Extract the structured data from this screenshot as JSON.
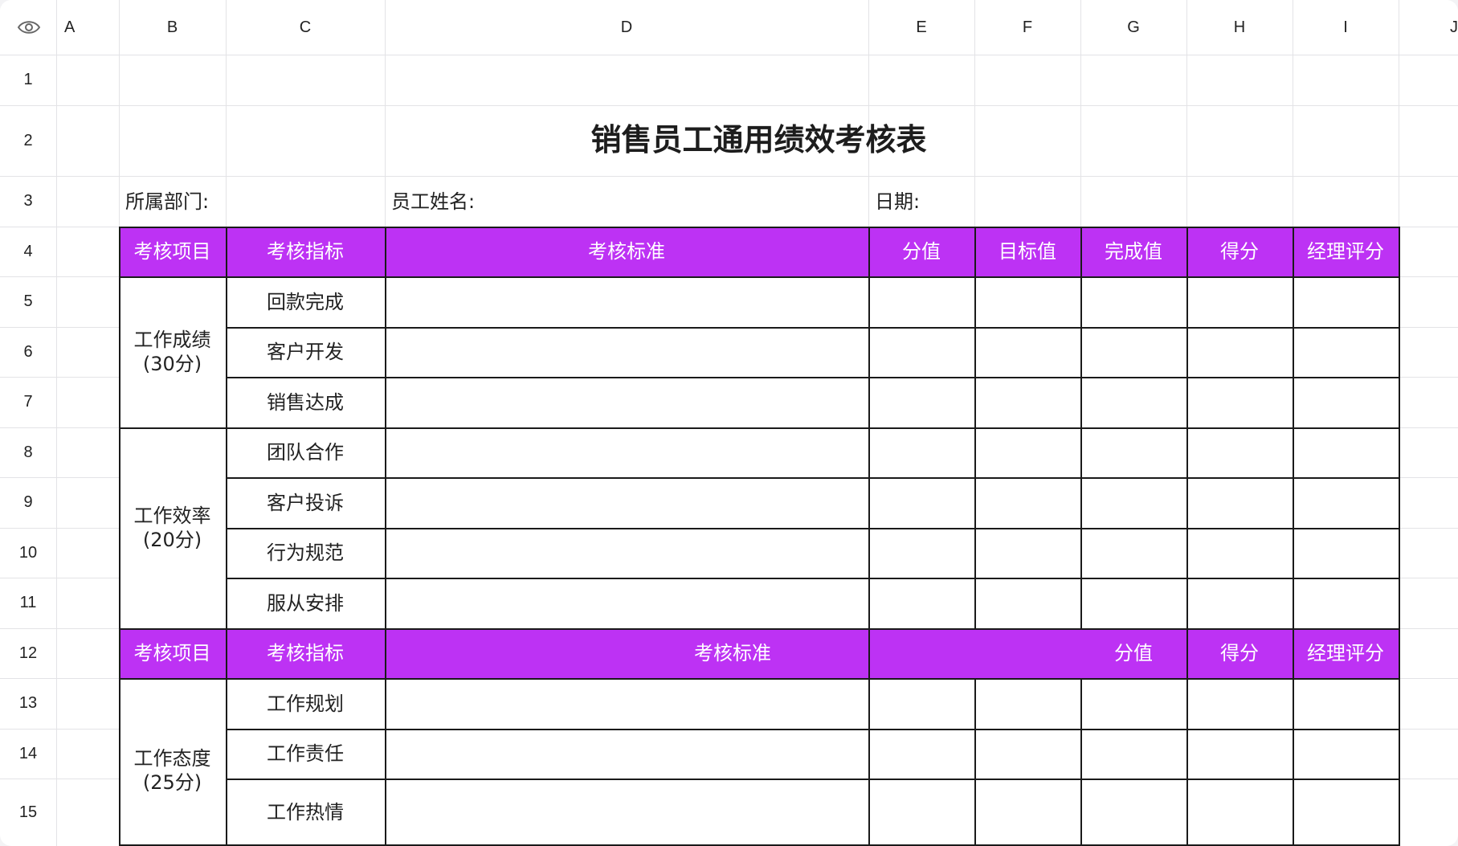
{
  "columns": [
    "A",
    "B",
    "C",
    "D",
    "E",
    "F",
    "G",
    "H",
    "I",
    "J"
  ],
  "rows": [
    "1",
    "2",
    "3",
    "4",
    "5",
    "6",
    "7",
    "8",
    "9",
    "10",
    "11",
    "12",
    "13",
    "14",
    "15"
  ],
  "title": "销售员工通用绩效考核表",
  "info": {
    "department": "所属部门:",
    "employee_name": "员工姓名:",
    "date": "日期:"
  },
  "header1": [
    "考核项目",
    "考核指标",
    "考核标准",
    "分值",
    "目标值",
    "完成值",
    "得分",
    "经理评分"
  ],
  "header2": [
    "考核项目",
    "考核指标",
    "考核标准",
    "分值",
    "得分",
    "经理评分"
  ],
  "groups": [
    {
      "category": "工作成绩\n(30分)",
      "items": [
        "回款完成",
        "客户开发",
        "销售达成"
      ]
    },
    {
      "category": "工作效率\n(20分)",
      "items": [
        "团队合作",
        "客户投诉",
        "行为规范",
        "服从安排"
      ]
    },
    {
      "category": "工作态度\n(25分)",
      "items": [
        "工作规划",
        "工作责任",
        "工作热情"
      ]
    }
  ],
  "colors": {
    "header_fill": "#bd32f4",
    "header_text": "#ffffff",
    "gridline": "#e3e3e6",
    "table_border": "#1a1a1a"
  },
  "icons": {
    "view": "eye-icon"
  }
}
